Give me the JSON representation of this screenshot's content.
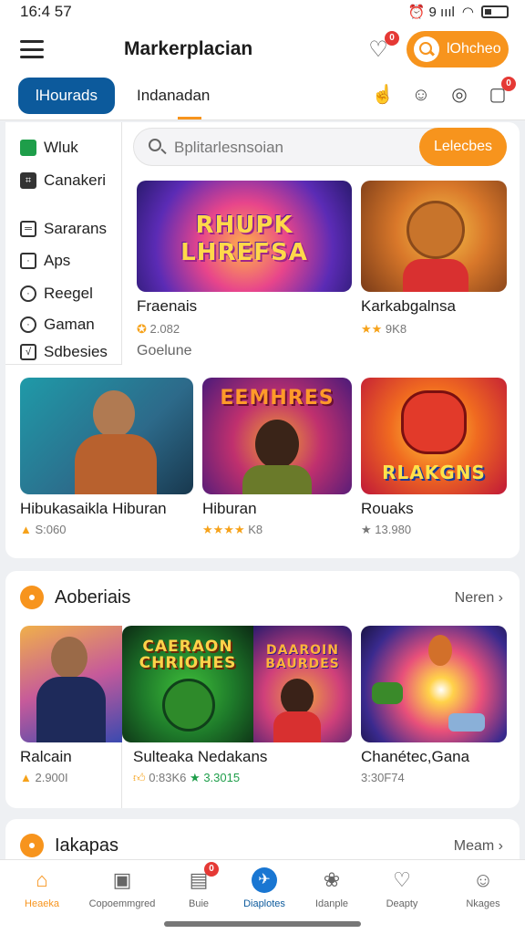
{
  "status": {
    "time": "16:4 57",
    "right": "⏰ 9 ıııl"
  },
  "appbar": {
    "title": "Markerplacian",
    "heart_badge": "0",
    "search_button": "lOhcheo"
  },
  "tabs": {
    "active": "lHourads",
    "second": "Indanadan",
    "notif_badge": "0"
  },
  "sidebar": {
    "items": [
      {
        "label": "Wluk",
        "icon": "store-icon"
      },
      {
        "label": "Canakeri",
        "icon": "gamepad-icon"
      },
      {
        "label": "Sararans",
        "icon": "list-icon"
      },
      {
        "label": "Aps",
        "icon": "app-icon"
      },
      {
        "label": "Reegel",
        "icon": "clock-icon"
      },
      {
        "label": "Gaman",
        "icon": "search-icon"
      },
      {
        "label": "Sdbesies",
        "icon": "chart-icon"
      }
    ]
  },
  "search": {
    "placeholder": "Bplitarlesnsoian",
    "button": "Lelecbes"
  },
  "featured": [
    {
      "art": "RHUPK LHREFSA",
      "title": "Fraenais",
      "meta": "2.082",
      "extra": "Goelune"
    },
    {
      "art": "",
      "title": "Karkabgalnsa",
      "meta": "9K8",
      "extra": ""
    }
  ],
  "grid": [
    {
      "art": "",
      "title": "Hibukasaikla Hiburan",
      "meta": "S:060"
    },
    {
      "art": "EEMHRES",
      "title": "Hiburan",
      "meta": "K8"
    },
    {
      "art": "RLAKGNS",
      "title": "Rouaks",
      "meta": "13.980"
    }
  ],
  "section1": {
    "title": "Aoberiais",
    "more": "Neren",
    "items": [
      {
        "art": "",
        "title": "Ralcain",
        "meta": "2.900I"
      },
      {
        "art": "CAERAON CHRIOHES",
        "title": "Sulteaka Nedakans",
        "meta": "0:83K6",
        "meta2": "3.3015"
      },
      {
        "art": "DAAROIN BAURDES",
        "title": "",
        "meta": ""
      },
      {
        "art": "",
        "title": "Chanétec,Gana",
        "meta": "3:30F74"
      }
    ]
  },
  "section2": {
    "title": "Iakapas",
    "more": "Meam"
  },
  "nav": [
    {
      "label": "Heaeka",
      "icon": "home-icon"
    },
    {
      "label": "Copoemmgred",
      "icon": "timer-icon"
    },
    {
      "label": "Buie",
      "icon": "inbox-icon",
      "badge": "0"
    },
    {
      "label": "Diaplotes",
      "icon": "explore-icon"
    },
    {
      "label": "Idanple",
      "icon": "grid-icon"
    },
    {
      "label": "Deapty",
      "icon": "heart-icon"
    },
    {
      "label": "Nkages",
      "icon": "user-icon"
    }
  ],
  "colors": {
    "accent": "#f7941d",
    "brand": "#0c5a9c",
    "badge": "#e53935"
  }
}
